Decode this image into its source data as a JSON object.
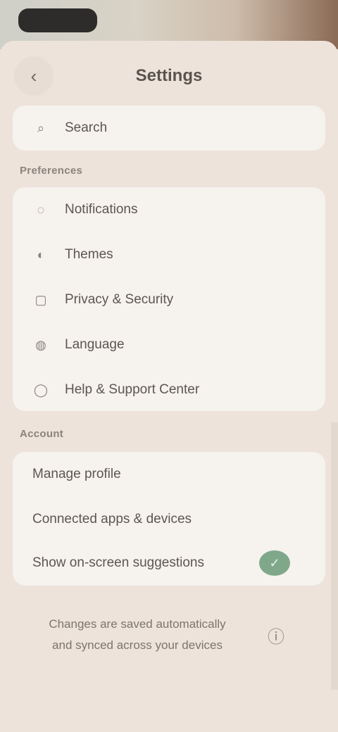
{
  "header": {
    "back_icon": "chevron-left-icon",
    "title": "Settings"
  },
  "search": {
    "icon": "search-icon",
    "label": "Search"
  },
  "sections": [
    {
      "label": "Preferences",
      "items": [
        {
          "icon": "bell-icon",
          "label": "Notifications"
        },
        {
          "icon": "palette-icon",
          "label": "Themes"
        },
        {
          "icon": "lock-icon",
          "label": "Privacy & Security"
        },
        {
          "icon": "globe-icon",
          "label": "Language"
        },
        {
          "icon": "help-icon",
          "label": "Help & Support Center"
        }
      ]
    },
    {
      "label": "Account",
      "items": [
        {
          "label": "Manage profile"
        },
        {
          "label": "Connected apps & devices"
        },
        {
          "label": "Show on-screen suggestions",
          "toggle": true
        }
      ]
    }
  ],
  "footer": {
    "text": "Changes are saved automatically and synced across your devices",
    "icon": "info-icon"
  },
  "colors": {
    "background": "#ece1d8",
    "card": "#f6f2ee",
    "toggle_on": "#7fa88b"
  }
}
